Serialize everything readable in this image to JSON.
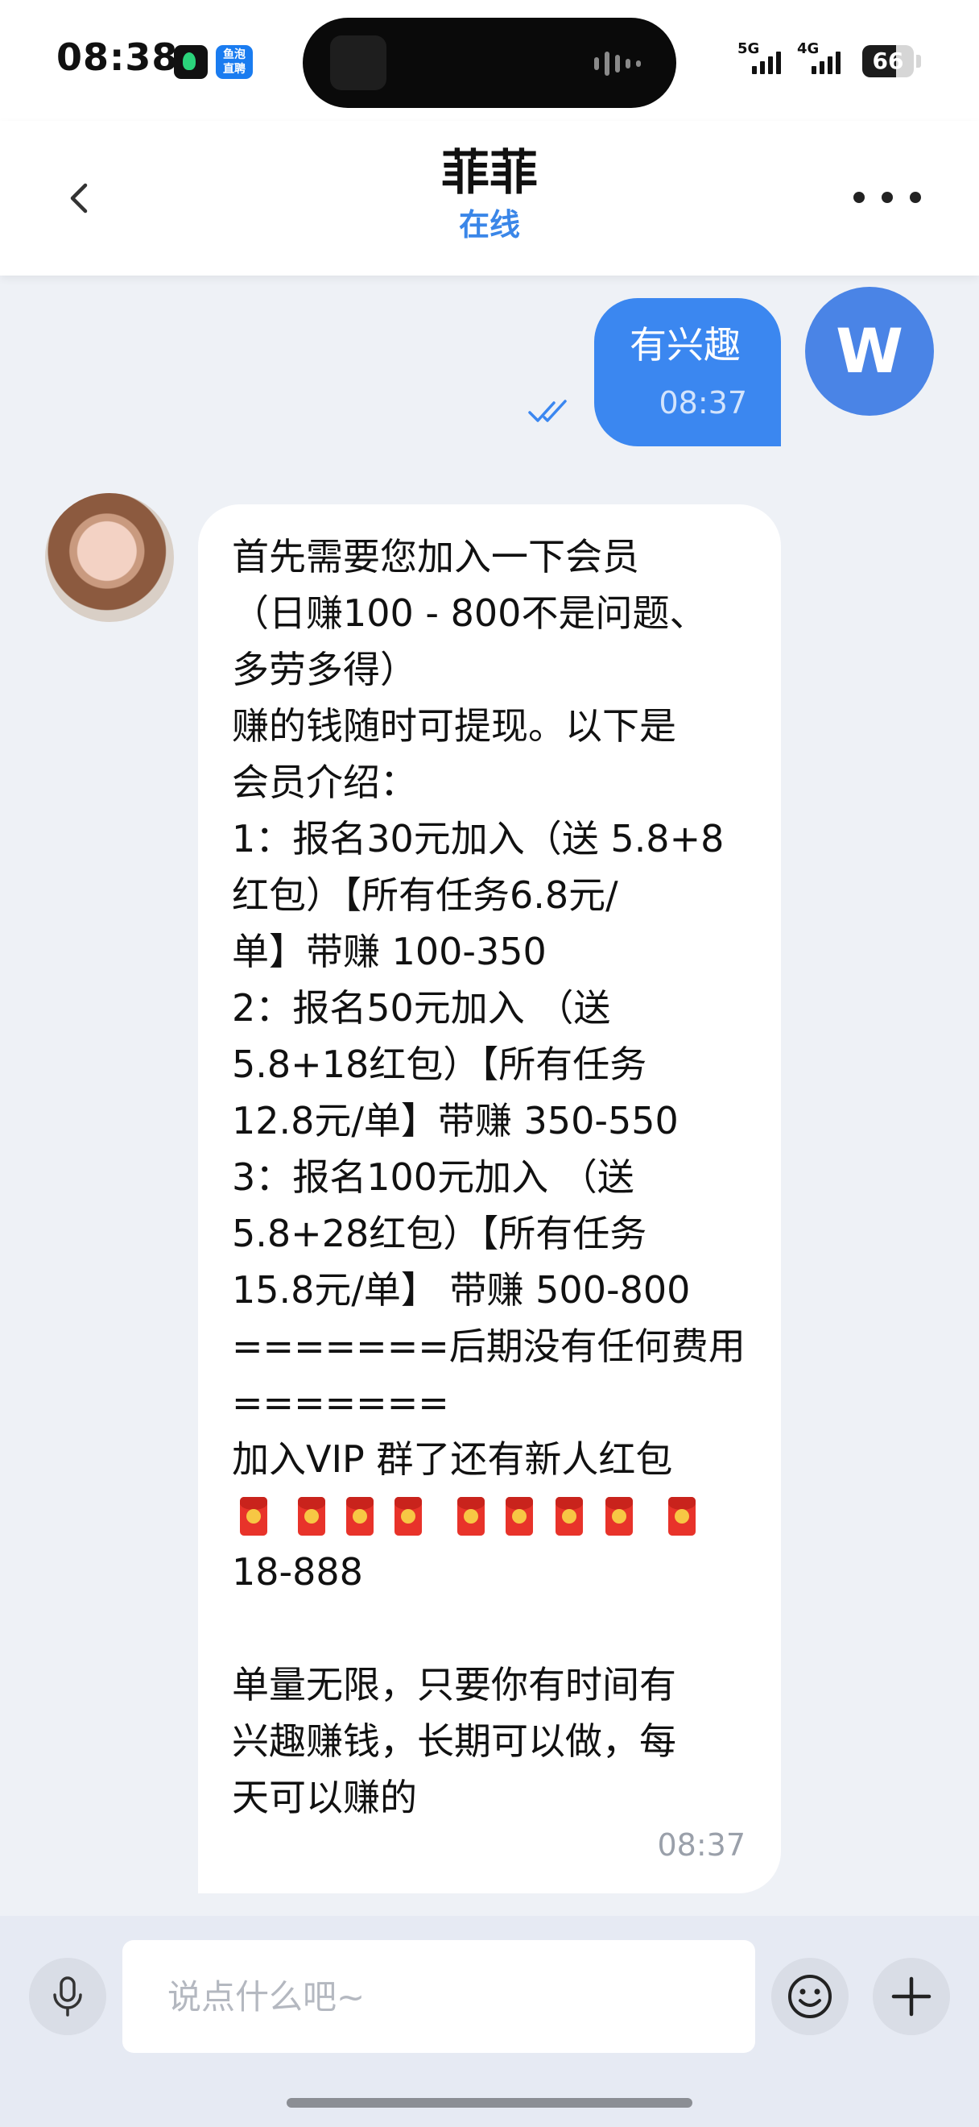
{
  "status_bar": {
    "time": "08:38",
    "app_icons": [
      "music-app-icon",
      "live-app-icon"
    ],
    "live_icon_label": "鱼泡\n直聘",
    "signal_1_label": "5G",
    "signal_2_label": "4G",
    "battery_level": "66"
  },
  "header": {
    "title": "菲菲",
    "status": "在线"
  },
  "messages": {
    "outgoing": {
      "text": "有兴趣",
      "time": "08:37",
      "read": true,
      "avatar_letter": "W"
    },
    "incoming": {
      "lines": [
        "首先需要您加入一下会员",
        "（日赚100 - 800不是问题、",
        "多劳多得）",
        "赚的钱随时可提现。以下是",
        "会员介绍：",
        "1：报名30元加入（送 5.8+8",
        "红包）【所有任务6.8元/",
        "单】带赚 100-350",
        "2：报名50元加入 （送",
        "5.8+18红包）【所有任务",
        "12.8元/单】带赚 350-550",
        "3：报名100元加入 （送",
        "5.8+28红包）【所有任务",
        "15.8元/单】 带赚 500-800",
        "=======后期没有任何费用",
        "=======",
        "加入VIP 群了还有新人红包"
      ],
      "redpacket_icon": "red-envelope-icon",
      "redpacket_count": 9,
      "after_lines": [
        "18-888",
        "",
        "单量无限，只要你有时间有",
        "兴趣赚钱，长期可以做，每",
        "天可以赚的"
      ],
      "time": "08:37"
    }
  },
  "input_bar": {
    "placeholder": "说点什么吧~",
    "value": ""
  },
  "colors": {
    "accent_blue": "#3b87f0",
    "status_blue": "#3a86e8",
    "background": "#eef1f6"
  }
}
